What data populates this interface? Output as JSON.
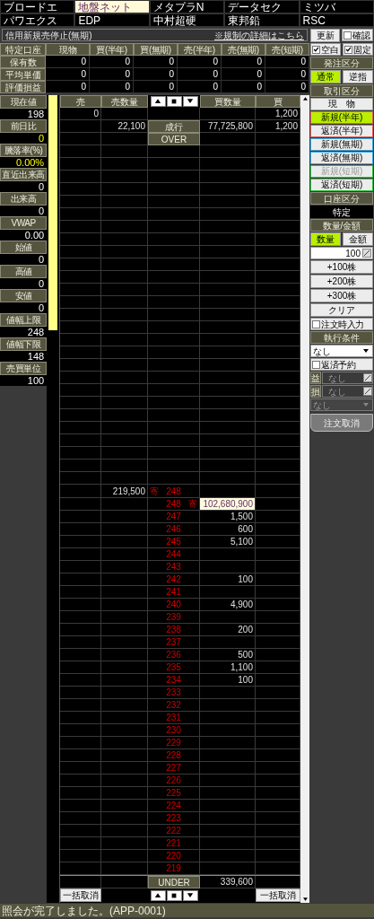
{
  "stock_tabs": [
    {
      "label": "ブロードエ",
      "selected": false
    },
    {
      "label": "地盤ネット",
      "selected": true
    },
    {
      "label": "メタプラN",
      "selected": false
    },
    {
      "label": "データセク",
      "selected": false
    },
    {
      "label": "ミツバ",
      "selected": false
    },
    {
      "label": "パワエクス",
      "selected": false
    },
    {
      "label": "EDP",
      "selected": false
    },
    {
      "label": "中村超硬",
      "selected": false
    },
    {
      "label": "東邦鉛",
      "selected": false
    },
    {
      "label": "RSC",
      "selected": false
    }
  ],
  "notice": {
    "text": "信用新規売停止(無期)",
    "link": "※規制の詳細はこちら"
  },
  "toolbar": {
    "refresh": "更新",
    "confirm": {
      "label": "確認",
      "checked": false
    },
    "blank": {
      "label": "空白",
      "checked": true
    },
    "fixed": {
      "label": "固定",
      "checked": true
    }
  },
  "positions": {
    "corner": "特定口座",
    "columns": [
      "現物",
      "買(半年)",
      "買(無期)",
      "売(半年)",
      "売(無期)",
      "売(短期)"
    ],
    "rows": [
      {
        "label": "保有数",
        "values": [
          "0",
          "0",
          "0",
          "0",
          "0",
          "0"
        ]
      },
      {
        "label": "平均単価",
        "values": [
          "0",
          "0",
          "0",
          "0",
          "0",
          "0"
        ]
      },
      {
        "label": "評価損益",
        "values": [
          "0",
          "0",
          "0",
          "0",
          "0",
          "0"
        ]
      }
    ]
  },
  "stats": [
    {
      "label": "現在値",
      "value": "198",
      "kind": "plain"
    },
    {
      "label": "前日比",
      "value": "0",
      "kind": "change"
    },
    {
      "label": "騰落率(%)",
      "value": "0.00%",
      "kind": "change"
    },
    {
      "label": "直近出来高",
      "value": "0",
      "kind": "plain"
    },
    {
      "label": "出来高",
      "value": "0",
      "kind": "plain"
    },
    {
      "label": "VWAP",
      "value": "0.00",
      "kind": "plain"
    },
    {
      "label": "始値",
      "value": "0",
      "kind": "plain"
    },
    {
      "label": "高値",
      "value": "0",
      "kind": "plain"
    },
    {
      "label": "安値",
      "value": "0",
      "kind": "plain"
    },
    {
      "label": "値幅上限",
      "value": "248",
      "kind": "plain"
    },
    {
      "label": "値幅下限",
      "value": "148",
      "kind": "plain"
    },
    {
      "label": "売買単位",
      "value": "100",
      "kind": "plain"
    }
  ],
  "order_book": {
    "columns": [
      "売",
      "売数量",
      "買数量",
      "買"
    ],
    "top_rows": [
      {
        "sell": "0",
        "buy": "1,200"
      },
      {
        "sell_qty": "22,100",
        "label": "成行",
        "buy_qty": "77,725,800",
        "buy": "1,200"
      },
      {
        "label": "OVER"
      }
    ],
    "price_rows": [
      {
        "sell_qty": "219,500",
        "sell_mark": "寄",
        "price": "248",
        "highlighted": false
      },
      {
        "price": "248",
        "buy_mark": "寄",
        "buy_qty": "102,680,900",
        "highlighted": true
      },
      {
        "price": "247",
        "buy_qty": "1,500",
        "highlighted": false
      },
      {
        "price": "246",
        "buy_qty": "600",
        "highlighted": false
      },
      {
        "price": "245",
        "buy_qty": "5,100",
        "highlighted": false
      },
      {
        "price": "244",
        "highlighted": false
      },
      {
        "price": "243",
        "highlighted": false
      },
      {
        "price": "242",
        "buy_qty": "100",
        "highlighted": false
      },
      {
        "price": "241",
        "highlighted": false
      },
      {
        "price": "240",
        "buy_qty": "4,900",
        "highlighted": false
      },
      {
        "price": "239",
        "highlighted": false
      },
      {
        "price": "238",
        "buy_qty": "200",
        "highlighted": false
      },
      {
        "price": "237",
        "highlighted": false
      },
      {
        "price": "236",
        "buy_qty": "500",
        "highlighted": false
      },
      {
        "price": "235",
        "buy_qty": "1,100",
        "highlighted": false
      },
      {
        "price": "234",
        "buy_qty": "100",
        "highlighted": false
      },
      {
        "price": "233",
        "highlighted": false
      },
      {
        "price": "232",
        "highlighted": false
      },
      {
        "price": "231",
        "highlighted": false
      },
      {
        "price": "230",
        "highlighted": false
      },
      {
        "price": "229",
        "highlighted": false
      },
      {
        "price": "228",
        "highlighted": false
      },
      {
        "price": "227",
        "highlighted": false
      },
      {
        "price": "226",
        "highlighted": false
      },
      {
        "price": "225",
        "highlighted": false
      },
      {
        "price": "224",
        "highlighted": false
      },
      {
        "price": "223",
        "highlighted": false
      },
      {
        "price": "222",
        "highlighted": false
      },
      {
        "price": "221",
        "highlighted": false
      },
      {
        "price": "220",
        "highlighted": false
      },
      {
        "price": "219",
        "highlighted": false
      }
    ],
    "under": {
      "label": "UNDER",
      "buy_qty": "339,600"
    },
    "cancel_buttons": [
      "一括取消",
      "一括取消"
    ]
  },
  "order_panel": {
    "order_type": {
      "title": "発注区分",
      "options": [
        {
          "label": "通常",
          "selected": true
        },
        {
          "label": "逆指",
          "selected": false
        }
      ]
    },
    "trade_type": {
      "title": "取引区分",
      "options": [
        {
          "label": "現　物",
          "selected": false,
          "disabled": false,
          "color": "#a0a0a0"
        },
        {
          "label": "新規(半年)",
          "selected": true,
          "disabled": false,
          "color": "#e06060"
        },
        {
          "label": "返済(半年)",
          "selected": false,
          "disabled": false,
          "color": "#e06060"
        },
        {
          "label": "新規(無期)",
          "selected": false,
          "disabled": false,
          "color": "#40a8e0"
        },
        {
          "label": "返済(無期)",
          "selected": false,
          "disabled": false,
          "color": "#40a8e0"
        },
        {
          "label": "新規(短期)",
          "selected": false,
          "disabled": true,
          "color": "#30c040"
        },
        {
          "label": "返済(短期)",
          "selected": false,
          "disabled": false,
          "color": "#30c040"
        }
      ]
    },
    "account": {
      "title": "口座区分",
      "value": "特定"
    },
    "quantity": {
      "title": "数量/金額",
      "modes": [
        {
          "label": "数量",
          "selected": true
        },
        {
          "label": "金額",
          "selected": false
        }
      ],
      "value": "100",
      "steps": [
        "+100株",
        "+200株",
        "+300株",
        "クリア"
      ],
      "input_on_order": {
        "label": "注文時入力",
        "checked": false
      }
    },
    "execution": {
      "title": "執行条件",
      "condition": "なし",
      "reserve": {
        "label": "返済予約",
        "checked": false
      },
      "profit": {
        "label": "益",
        "value": "なし",
        "disabled": true
      },
      "loss": {
        "label": "損",
        "value": "なし",
        "disabled": true
      },
      "extra": {
        "value": "なし",
        "disabled": true
      },
      "cancel": "注文取消"
    }
  },
  "status": "照会が完了しました。(APP-0001)"
}
